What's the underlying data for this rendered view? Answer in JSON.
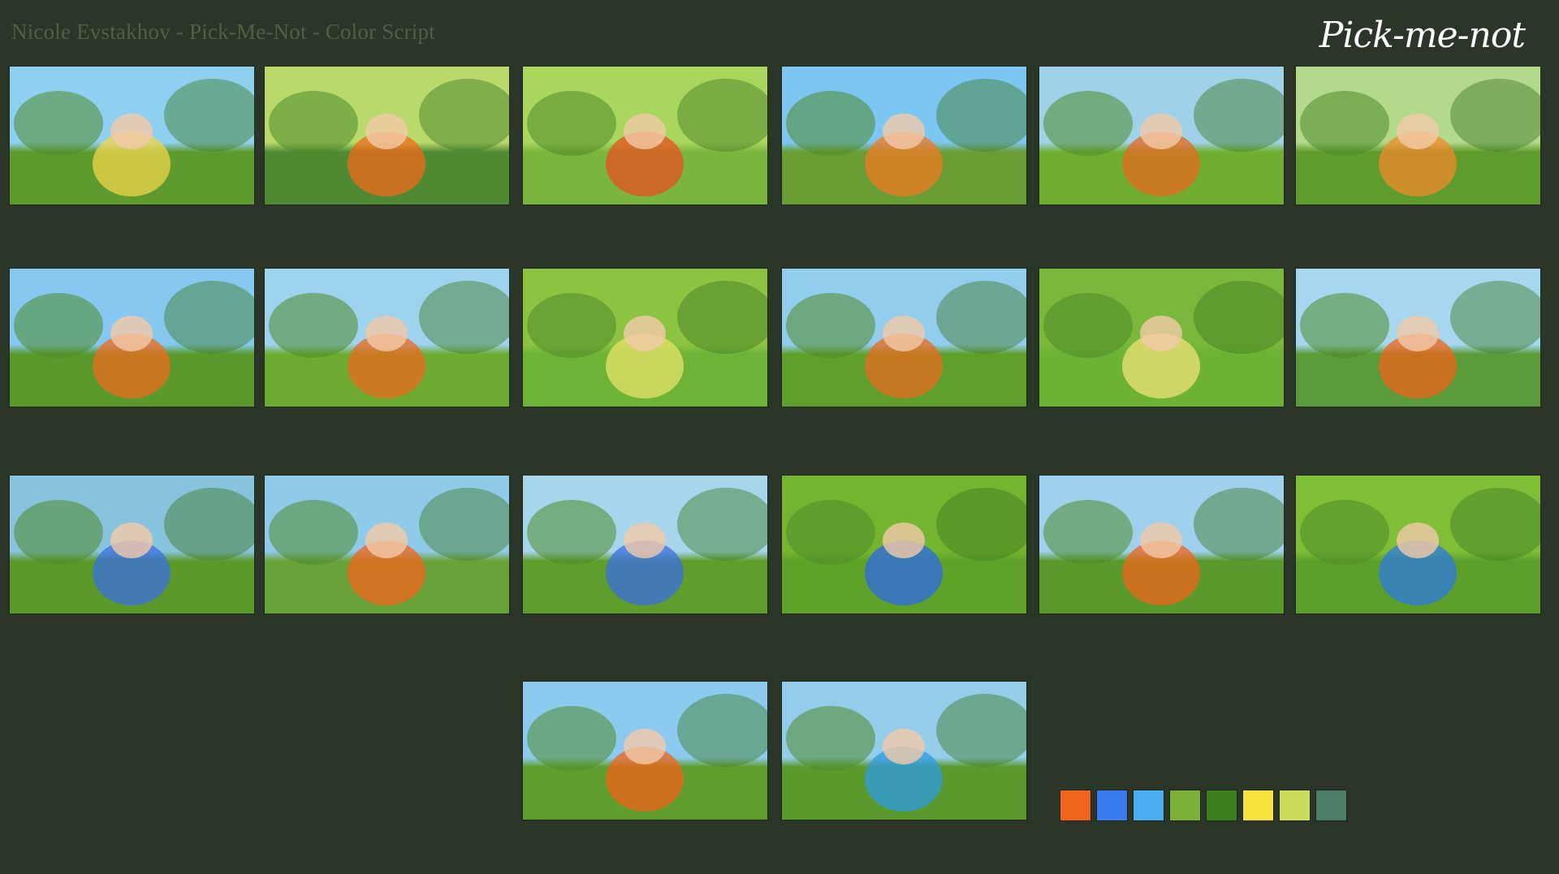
{
  "header": {
    "title": "Nicole Evstakhov - Pick-Me-Not - Color Script",
    "logo_text": "Pick-me-not"
  },
  "frames": [
    {
      "name": "frame-flowers-hand",
      "sky": "#8fd0f0",
      "ground": "#5e9b2f",
      "accent": "#f2d54a"
    },
    {
      "name": "frame-girl-hat-flower",
      "sky": "#b9d96b",
      "ground": "#4f8a33",
      "accent": "#f06a1c"
    },
    {
      "name": "frame-basket-closeup",
      "sky": "#a9d65c",
      "ground": "#7ab53d",
      "accent": "#e7511e"
    },
    {
      "name": "frame-girl-sitting-flower",
      "sky": "#7cc6f2",
      "ground": "#6a9e34",
      "accent": "#f07a22"
    },
    {
      "name": "frame-meadow-picnic",
      "sky": "#9fd2e8",
      "ground": "#6fae31",
      "accent": "#e66a1f"
    },
    {
      "name": "frame-blur-sprout",
      "sky": "#b3d98a",
      "ground": "#5e9c2d",
      "accent": "#f08a2a"
    },
    {
      "name": "frame-girl-holding-creature",
      "sky": "#86c8ef",
      "ground": "#5a9a2c",
      "accent": "#ee6b1d"
    },
    {
      "name": "frame-girl-lying-tree",
      "sky": "#9dd3ed",
      "ground": "#6cab30",
      "accent": "#ea6a1f"
    },
    {
      "name": "frame-onion-creature",
      "sky": "#8cc441",
      "ground": "#6eb336",
      "accent": "#e4e36a"
    },
    {
      "name": "frame-girl-resting-tree",
      "sky": "#93cdee",
      "ground": "#5fa02d",
      "accent": "#e86a1d"
    },
    {
      "name": "frame-creature-pink-meadow",
      "sky": "#79b83a",
      "ground": "#6db233",
      "accent": "#efe27a"
    },
    {
      "name": "frame-girl-surprised",
      "sky": "#a6d7ef",
      "ground": "#5c9b3a",
      "accent": "#f0641b"
    },
    {
      "name": "frame-blue-creatures-basket",
      "sky": "#88c3dd",
      "ground": "#5b9a2a",
      "accent": "#3a6fe0"
    },
    {
      "name": "frame-girl-thinking",
      "sky": "#8fcbe9",
      "ground": "#6aa23a",
      "accent": "#f0641b"
    },
    {
      "name": "frame-girl-under-tree",
      "sky": "#a7d5ec",
      "ground": "#5f9d2c",
      "accent": "#3a6fe0"
    },
    {
      "name": "frame-blue-creatures-closeup",
      "sky": "#73b52f",
      "ground": "#5ea22a",
      "accent": "#2e68e6"
    },
    {
      "name": "frame-girl-eyes-closed-tree",
      "sky": "#9fd0ec",
      "ground": "#5a9a2c",
      "accent": "#f0641b"
    },
    {
      "name": "frame-creature-pointing",
      "sky": "#7fbe37",
      "ground": "#5c9f2b",
      "accent": "#2e7ae0"
    },
    {
      "name": "frame-girl-hugging-tree",
      "sky": "#8ccbef",
      "ground": "#5f9d2c",
      "accent": "#f0641b"
    },
    {
      "name": "frame-final-forest",
      "sky": "#93cdea",
      "ground": "#5a9a2c",
      "accent": "#2e9ae0"
    }
  ],
  "palette": [
    "#f0641b",
    "#3a7cf0",
    "#4aaff0",
    "#7ab03a",
    "#3c7f1f",
    "#f5e23a",
    "#cbdc5a",
    "#4d7f68"
  ]
}
